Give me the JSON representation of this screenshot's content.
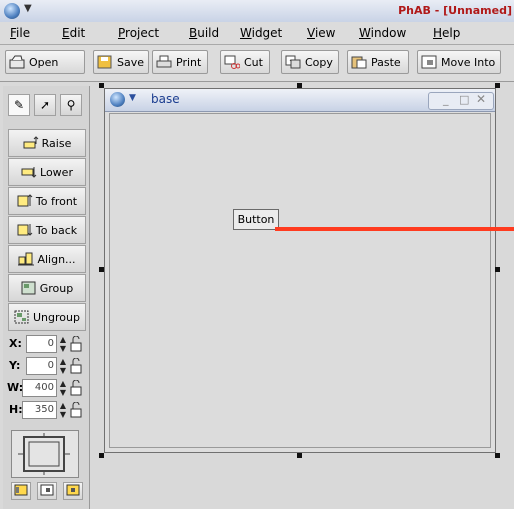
{
  "window": {
    "title": "PhAB - [Unnamed]"
  },
  "menubar": {
    "items": [
      "File",
      "Edit",
      "Project",
      "Build",
      "Widget",
      "View",
      "Window",
      "Help"
    ]
  },
  "toolbar": {
    "buttons": [
      {
        "label": "Open",
        "icon": "open-icon"
      },
      {
        "label": "Save",
        "icon": "save-icon"
      },
      {
        "label": "Print",
        "icon": "print-icon"
      },
      {
        "label": "Cut",
        "icon": "cut-icon"
      },
      {
        "label": "Copy",
        "icon": "copy-icon"
      },
      {
        "label": "Paste",
        "icon": "paste-icon"
      },
      {
        "label": "Move Into",
        "icon": "move-into-icon"
      }
    ]
  },
  "palette": {
    "tools": [
      {
        "label": "Raise"
      },
      {
        "label": "Lower"
      },
      {
        "label": "To front"
      },
      {
        "label": "To back"
      },
      {
        "label": "Align..."
      },
      {
        "label": "Group"
      },
      {
        "label": "Ungroup"
      }
    ],
    "fields": [
      {
        "label": "X:",
        "value": "0"
      },
      {
        "label": "Y:",
        "value": "0"
      },
      {
        "label": "W:",
        "value": "400"
      },
      {
        "label": "H:",
        "value": "350"
      }
    ]
  },
  "base_window": {
    "title": "base"
  },
  "widget": {
    "label": "Button"
  },
  "colors": {
    "title_text": "#b01818",
    "selection_line": "#ff3b1f"
  }
}
